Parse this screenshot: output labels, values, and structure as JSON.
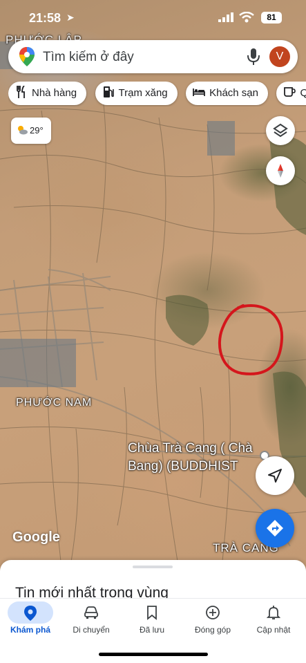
{
  "status_bar": {
    "time": "21:58",
    "battery": "81"
  },
  "search": {
    "placeholder": "Tìm kiếm ở đây",
    "avatar_initial": "V"
  },
  "chips": [
    {
      "label": "Nhà hàng",
      "icon": "fork-knife-icon"
    },
    {
      "label": "Trạm xăng",
      "icon": "gas-pump-icon"
    },
    {
      "label": "Khách sạn",
      "icon": "bed-icon"
    },
    {
      "label": "Quán",
      "icon": "coffee-cup-icon"
    }
  ],
  "weather": {
    "temp": "29°",
    "icon": "partly-cloudy-icon"
  },
  "map": {
    "labels": {
      "phuoc_lap": "PHƯỚC LẬP",
      "phuoc_nam": "PHƯỚC NAM",
      "chua": "Chùa Trà Cang ( Chà Bang) (BUDDHIST",
      "tra_cang": "TRÀ CANG"
    },
    "attribution": "Google",
    "annotation_color": "#d4161c"
  },
  "sheet": {
    "heading": "Tin mới nhất trong vùng"
  },
  "nav": [
    {
      "label": "Khám phá",
      "icon": "explore-pin-icon",
      "active": true
    },
    {
      "label": "Di chuyển",
      "icon": "car-icon",
      "active": false
    },
    {
      "label": "Đã lưu",
      "icon": "bookmark-icon",
      "active": false
    },
    {
      "label": "Đóng góp",
      "icon": "add-circle-icon",
      "active": false
    },
    {
      "label": "Cập nhật",
      "icon": "bell-icon",
      "active": false
    }
  ],
  "colors": {
    "accent": "#1a73e8",
    "nav_active_bg": "#d3e3fd",
    "avatar_bg": "#c1441e"
  }
}
